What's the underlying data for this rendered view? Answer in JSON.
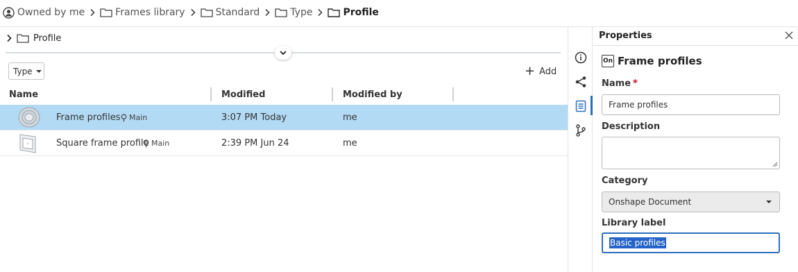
{
  "breadcrumb": [
    {
      "label": "Owned by me",
      "icon": "user-icon"
    },
    {
      "label": "Frames library",
      "icon": "folder-icon"
    },
    {
      "label": "Standard",
      "icon": "folder-icon"
    },
    {
      "label": "Type",
      "icon": "folder-icon"
    },
    {
      "label": "Profile",
      "icon": "folder-icon",
      "current": true
    }
  ],
  "folder": {
    "name": "Profile"
  },
  "toolbar": {
    "type_filter": "Type",
    "add_label": "Add"
  },
  "table": {
    "columns": [
      "Name",
      "Modified",
      "Modified by"
    ],
    "rows": [
      {
        "name": "Frame profiles",
        "branch": "Main",
        "modified": "3:07 PM Today",
        "modified_by": "me",
        "selected": true
      },
      {
        "name": "Square frame profile",
        "branch": "Main",
        "modified": "2:39 PM Jun 24",
        "modified_by": "me",
        "selected": false
      }
    ]
  },
  "rail": [
    "info-icon",
    "share-icon",
    "properties-icon",
    "branch-icon"
  ],
  "properties": {
    "title": "Properties",
    "doc_title": "Frame profiles",
    "doc_badge": "On",
    "name_label": "Name",
    "required_mark": "*",
    "name_value": "Frame profiles",
    "description_label": "Description",
    "description_value": "",
    "category_label": "Category",
    "category_value": "Onshape Document",
    "library_label": "Library label",
    "library_value": "Basic profiles"
  },
  "colors": {
    "selection": "#b3daf4",
    "accent": "#2a6ebb",
    "required": "#d0021b"
  }
}
